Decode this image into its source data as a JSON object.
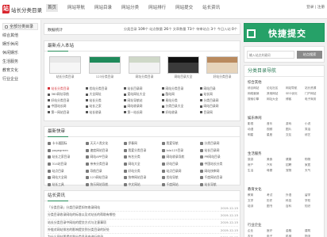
{
  "header": {
    "logo_mark": "站",
    "logo_text": "站长分类目录",
    "nav": [
      "首页",
      "网站导航",
      "网站目录",
      "网站分类",
      "网站排行",
      "网站提交",
      "站长资讯"
    ],
    "login_text": "登录 | 注册"
  },
  "sidebar": {
    "title": "全部分类目录",
    "items": [
      "综合其他",
      "娱乐休闲",
      "休闲娱乐",
      "生活服务",
      "教育文化",
      "行业企业"
    ]
  },
  "stats": {
    "title": "数据统计",
    "items": [
      {
        "label": "分类目录",
        "value": "109"
      },
      {
        "label": "站点数量",
        "value": "26"
      },
      {
        "label": "文章数量",
        "value": "73"
      },
      {
        "label": "待审站点",
        "value": "3"
      },
      {
        "label": "今日入站",
        "value": "0"
      }
    ],
    "unit": "个"
  },
  "latest": {
    "title": "最新点入本站",
    "thumbs": [
      {
        "caption": "站长分类目录",
        "color_top": "#e8e8e8",
        "color_bottom": "#f6f6f6"
      },
      {
        "caption": "123分类目录",
        "color_top": "#1f8a5a",
        "color_bottom": "#e9e9e9"
      },
      {
        "caption": "网址分类目录",
        "color_top": "#cfd8c8",
        "color_bottom": "#f2f2f2"
      },
      {
        "caption": "网站目录大全",
        "color_top": "#111111",
        "color_bottom": "#3a3a3a"
      },
      {
        "caption": "好站分类目录",
        "color_top": "#b98a5e",
        "color_bottom": "#e6d4bb"
      }
    ],
    "grid": [
      [
        "站长分类目录",
        "优站分类目录",
        "站长目录网",
        "网站分类目录",
        "网站目录"
      ],
      [
        "360网址导航",
        "大全网址",
        "爱站网址大全",
        "酷站网",
        "站长网"
      ],
      [
        "好站分类目录",
        "站长分类",
        "网址导航站",
        "易站分类",
        "分类目录网"
      ],
      [
        "中国站长网",
        "站长之家",
        "网站收录网",
        "分类目录大全",
        "网站目录网"
      ],
      [
        "第一网站目录",
        "站长收录",
        "第一站长网",
        "好站收录",
        "目录网"
      ]
    ]
  },
  "fast": {
    "title": "最新快审",
    "grid": [
      [
        "卡卡通国际",
        "天天人类文化",
        "伊春网",
        "我爱导航",
        "分类目录网"
      ],
      [
        "pagegreen",
        "速度网站目录",
        "我爱分类目录",
        "lolo123目录",
        "站长目录网"
      ],
      [
        "站长之家目录",
        "网站APP目录",
        "有名分类",
        "网站收录导航",
        "PR网站目录"
      ],
      [
        "314站目录",
        "亲亲分类目录",
        "网站大全",
        "好站目录",
        "中国站长分类"
      ],
      [
        "站点目录",
        "导航目录",
        "好站分类",
        "站点目录网",
        "网站快审网"
      ],
      [
        "网站大全网",
        "123网站目录",
        "快审网站目录",
        "优站导航",
        "千度网站目录"
      ],
      [
        "站长工具",
        "快乐网站导航",
        "中文网站",
        "千度网站",
        "站长导航"
      ]
    ]
  },
  "news": {
    "title": "站长资讯",
    "items": [
      {
        "title": "「分类目录」分类目录是如何收录网站",
        "date": "2019-12-15"
      },
      {
        "title": "分类目录收录网站的标准以及对站长的帮助有哪些",
        "date": "2019-12-15"
      },
      {
        "title": "站长分类目录中网站的提交方式与注意事项",
        "date": "2019-12-15"
      },
      {
        "title": "外链对网站排名的影响提交到分类目录的好处",
        "date": "2019-12-15"
      },
      {
        "title": "为什么网站要提交到分类目录中进行收录",
        "date": "2019-12-15"
      }
    ]
  },
  "submit_banner": {
    "text": "快捷提交"
  },
  "search": {
    "placeholder": "输入站点关键词",
    "button": "站点搜索"
  },
  "categories": {
    "title": "分类目录导航",
    "sections": [
      {
        "title": "综合其他",
        "rows": [
          [
            "综合网站",
            "论坛社区",
            "网站导航",
            "站长资源"
          ],
          [
            "网络营销",
            "其他网站",
            "SEO优化",
            "门户网站"
          ],
          [
            "搜索引擎",
            "网址大全",
            "博客",
            "电子商务"
          ]
        ]
      },
      {
        "title": "娱乐休闲",
        "rows": [
          [
            "影视",
            "音乐",
            "游戏",
            "小说"
          ],
          [
            "动漫",
            "视频",
            "图片",
            "笑话"
          ],
          [
            "明星",
            "星座",
            "交友",
            "综艺"
          ]
        ]
      },
      {
        "title": "生活服务",
        "rows": [
          [
            "旅游",
            "美食",
            "健康",
            "购物"
          ],
          [
            "房产",
            "汽车",
            "招聘",
            "家居"
          ],
          [
            "生活",
            "母婴",
            "宠物",
            "天气"
          ]
        ]
      },
      {
        "title": "教育文化",
        "rows": [
          [
            "教育",
            "考试",
            "外语",
            "留学"
          ],
          [
            "文学",
            "历史",
            "科技",
            "学校"
          ],
          [
            "培训",
            "图书",
            "百科",
            "知识"
          ]
        ]
      },
      {
        "title": "行业企业",
        "rows": [
          [
            "企业",
            "医疗",
            "金融",
            "建筑"
          ],
          [
            "农业",
            "电子",
            "机械",
            "物流"
          ]
        ]
      }
    ]
  },
  "colors": {
    "accent": "#26a168",
    "hot": "#d4333a",
    "logo": "#d9262f"
  }
}
